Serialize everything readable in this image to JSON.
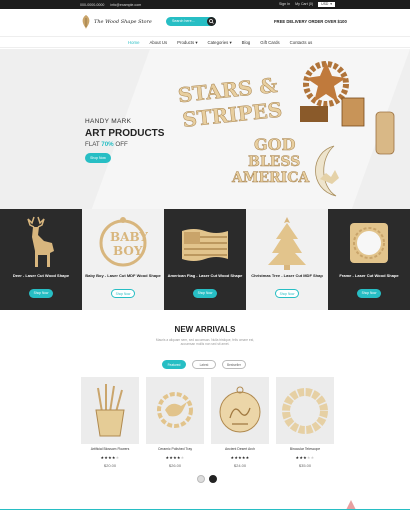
{
  "topbar": {
    "phone": "000-0000-0000",
    "email": "info@example.com",
    "sign_in": "Sign In",
    "my_cart": "My Cart (0)",
    "currency": "USD"
  },
  "header": {
    "store_name": "The Wood Shape Store",
    "search_placeholder": "Search here...",
    "promo": "FREE DELIVERY ORDER OVER $100"
  },
  "nav": {
    "items": [
      "Home",
      "About Us",
      "Products",
      "Categories",
      "Blog",
      "Gift Cards",
      "Contacts us"
    ]
  },
  "hero": {
    "line1": "HANDY MARK",
    "line2": "ART PRODUCTS",
    "line3_prefix": "FLAT",
    "discount": "70%",
    "line3_suffix": "OFF",
    "cta": "Shop Now",
    "image_text": {
      "stars": "STARS &",
      "stripes": "STRIPES",
      "god_bless": "GOD",
      "bless": "BLESS",
      "america": "AMERICA"
    }
  },
  "categories": [
    {
      "label": "Deer - Laser Cut Wood Shape",
      "cta": "Shop Now",
      "icon": "deer-icon"
    },
    {
      "label": "Baby Boy - Laser Cut MDF Wood Shape",
      "cta": "Shop Now",
      "icon": "baby-boy-icon"
    },
    {
      "label": "American Flag - Laser Cut Wood Shape",
      "cta": "Shop Now",
      "icon": "flag-icon"
    },
    {
      "label": "Christmas Tree - Laser Cut MDF Shap",
      "cta": "Shop Now",
      "icon": "tree-icon"
    },
    {
      "label": "Frame - Laser Cut Wood Shape",
      "cta": "Shop Now",
      "icon": "frame-icon"
    }
  ],
  "new_arrivals": {
    "title": "NEW ARRIVALS",
    "subtitle": "Mauris a aliquam sem, sed accumsan. Nulla tristique, felis ornare est, accumsan mollis non sed sit amet.",
    "tabs": [
      "Featured",
      "Latest",
      "Bestseller"
    ],
    "products": [
      {
        "name": "Artificial Blossom Flowers",
        "price": "$20.00"
      },
      {
        "name": "Ceramic Polished Tray",
        "price": "$26.00"
      },
      {
        "name": "Ancient Desert Arch",
        "price": "$24.00"
      },
      {
        "name": "Binocular Telescope",
        "price": "$35.00"
      }
    ]
  },
  "colors": {
    "accent": "#27bec4",
    "dark": "#2b2b2b",
    "wood": "#e6c990"
  }
}
